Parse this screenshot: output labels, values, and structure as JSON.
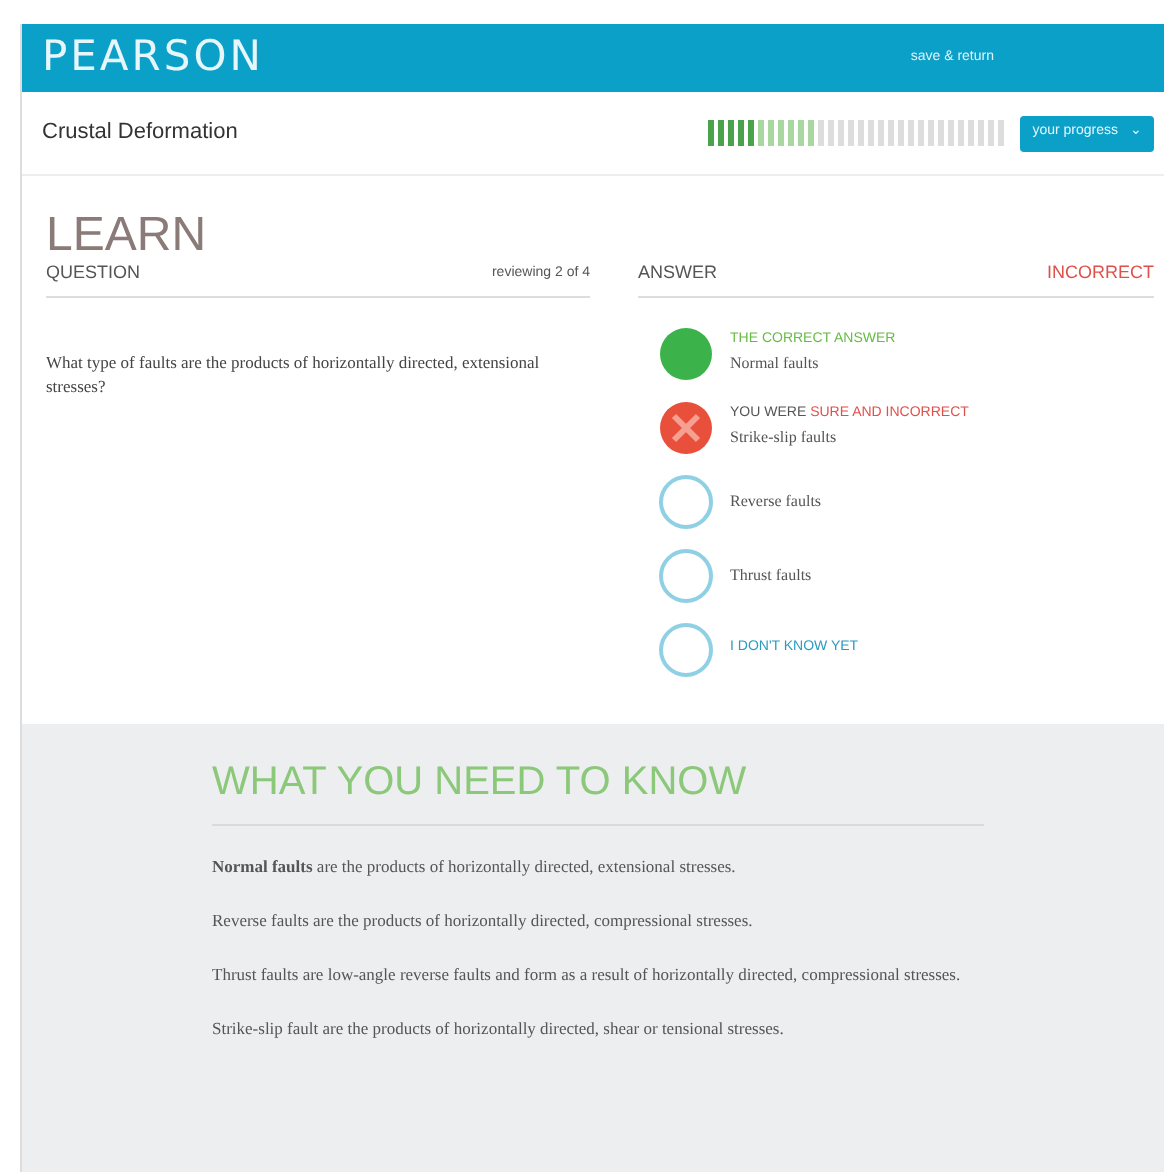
{
  "header": {
    "logo": "PEARSON",
    "link": "save & return"
  },
  "topic": {
    "title": "Crustal Deformation",
    "progress": {
      "mastered": {
        "level": 0.17
      },
      "learning": {
        "level": 0.2
      }
    },
    "button": "your progress",
    "caret": "⌄"
  },
  "mode_title": "LEARN",
  "question": {
    "heading": "QUESTION",
    "counter": "reviewing 2 of 4",
    "text": "What type of faults are the products of horizontally directed, extensional stresses?"
  },
  "answer": {
    "heading": "ANSWER",
    "result": "INCORRECT",
    "options": [
      {
        "kind": "correct",
        "status": "THE CORRECT ANSWER",
        "label": "Normal faults"
      },
      {
        "kind": "wrong",
        "status": "YOU WERE",
        "status_detail": "SURE AND INCORRECT",
        "label": "Strike-slip faults"
      },
      {
        "kind": "plain",
        "label": "Reverse faults"
      },
      {
        "kind": "plain",
        "label": "Thrust faults"
      },
      {
        "kind": "unknown",
        "label": "I DON'T KNOW YET"
      }
    ]
  },
  "know": {
    "heading": "WHAT YOU NEED TO KNOW",
    "paragraphs": [
      "**Normal faults** are the products of horizontally directed, extensional stresses.",
      "Reverse faults are the products of horizontally directed, compressional stresses.",
      "Thrust faults are low-angle reverse faults and form as a result of horizontally directed, compressional stresses.",
      "Strike-slip fault are the products of horizontally directed, shear or tensional stresses."
    ]
  }
}
